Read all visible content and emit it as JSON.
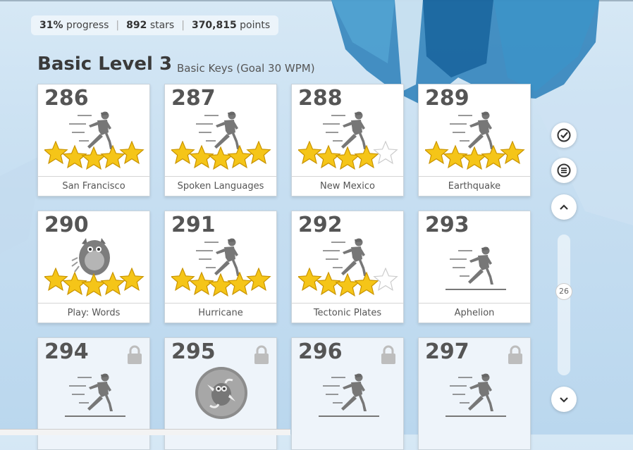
{
  "stats": {
    "progress": "31%",
    "progress_label": "progress",
    "stars": "892",
    "stars_label": "stars",
    "points": "370,815",
    "points_label": "points"
  },
  "level": {
    "title": "Basic Level 3",
    "subtitle": "Basic Keys (Goal 30 WPM)"
  },
  "lessons": [
    {
      "num": "286",
      "name": "San Francisco",
      "stars": 5,
      "icon": "runner-icon"
    },
    {
      "num": "287",
      "name": "Spoken Languages",
      "stars": 5,
      "icon": "runner-icon"
    },
    {
      "num": "288",
      "name": "New Mexico",
      "stars": 4,
      "icon": "runner-icon"
    },
    {
      "num": "289",
      "name": "Earthquake",
      "stars": 5,
      "icon": "runner-icon"
    },
    {
      "num": "290",
      "name": "Play: Words",
      "stars": 5,
      "icon": "monster-icon"
    },
    {
      "num": "291",
      "name": "Hurricane",
      "stars": 5,
      "icon": "runner-icon"
    },
    {
      "num": "292",
      "name": "Tectonic Plates",
      "stars": 4,
      "icon": "runner-icon"
    },
    {
      "num": "293",
      "name": "Aphelion",
      "stars": 0,
      "icon": "runner-icon"
    },
    {
      "num": "294",
      "name": "",
      "stars": 0,
      "icon": "runner-icon",
      "locked": true
    },
    {
      "num": "295",
      "name": "",
      "stars": 0,
      "icon": "bubble-monster-icon",
      "locked": true
    },
    {
      "num": "296",
      "name": "",
      "stars": 0,
      "icon": "runner-icon",
      "locked": true
    },
    {
      "num": "297",
      "name": "",
      "stars": 0,
      "icon": "runner-icon",
      "locked": true
    }
  ],
  "scroll": {
    "position_label": "26"
  },
  "controls": [
    "check-icon",
    "menu-icon",
    "chevron-up-icon",
    "chevron-down-icon"
  ],
  "colors": {
    "star": "#f5c518",
    "star_border": "#c99400",
    "accent": "#1f6fa8"
  }
}
